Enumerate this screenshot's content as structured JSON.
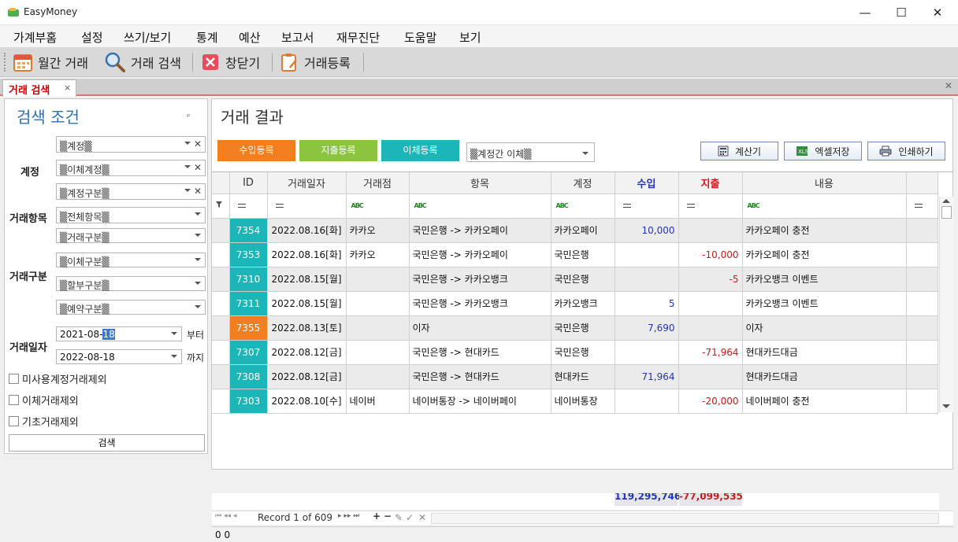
{
  "app": {
    "title": "EasyMoney",
    "win_min": "—",
    "win_max": "☐",
    "win_close": "✕"
  },
  "menu": [
    "가계부홈",
    "설정",
    "쓰기/보기",
    "통계",
    "예산",
    "보고서",
    "재무진단",
    "도움말",
    "보기"
  ],
  "toolbar": {
    "monthly": "월간 거래",
    "search": "거래 검색",
    "close": "창닫기",
    "register": "거래등록"
  },
  "doc_tab": {
    "label": "거래 검색",
    "close": "×"
  },
  "search_panel": {
    "title": "검색 조건",
    "pin": "ₚ",
    "group_account": "계정",
    "group_item": "거래항목",
    "group_type": "거래구분",
    "group_date": "거래일자",
    "account": "▒계정▒",
    "transfer_account": "▒이체계정▒",
    "account_type": "▒계정구분▒",
    "all_items": "▒전체항목▒",
    "trade_type": "▒거래구분▒",
    "transfer_type": "▒이체구분▒",
    "installment_type": "▒할부구분▒",
    "reservation_type": "▒예약구분▒",
    "date_from_prefix": "2021-08-",
    "date_from_sel": "18",
    "date_to": "2022-08-18",
    "from_suffix": "부터",
    "to_suffix": "까지",
    "chk_unused": "미사용계정거래제외",
    "chk_transfer": "이체거래제외",
    "chk_base": "기초거래제외",
    "search_btn": "검색"
  },
  "results": {
    "title": "거래 결과",
    "income_btn": "수입등록",
    "expense_btn": "지출등록",
    "transfer_btn": "이체등록",
    "transfer_filter": "▒계정간 이체▒",
    "calc_btn": "계산기",
    "excel_btn": "엑셀저장",
    "print_btn": "인쇄하기",
    "columns": [
      "ID",
      "거래일자",
      "거래점",
      "항목",
      "계정",
      "수입",
      "지출",
      "내용"
    ],
    "filter_abc": "ABC",
    "rows": [
      {
        "id": "7354",
        "date": "2022.08.16[화]",
        "store": "카카오",
        "item": "국민은행 -> 카카오페이",
        "account": "카카오페이",
        "income": "10,000",
        "expense": "",
        "memo": "카카오페이 충전"
      },
      {
        "id": "7353",
        "date": "2022.08.16[화]",
        "store": "카카오",
        "item": "국민은행 -> 카카오페이",
        "account": "국민은행",
        "income": "",
        "expense": "-10,000",
        "memo": "카카오페이 충전"
      },
      {
        "id": "7310",
        "date": "2022.08.15[월]",
        "store": "",
        "item": "국민은행 -> 카카오뱅크",
        "account": "국민은행",
        "income": "",
        "expense": "-5",
        "memo": "카카오뱅크 이벤트"
      },
      {
        "id": "7311",
        "date": "2022.08.15[월]",
        "store": "",
        "item": "국민은행 -> 카카오뱅크",
        "account": "카카오뱅크",
        "income": "5",
        "expense": "",
        "memo": "카카오뱅크 이벤트"
      },
      {
        "id": "7355",
        "date": "2022.08.13[토]",
        "store": "",
        "item": "이자",
        "account": "국민은행",
        "income": "7,690",
        "expense": "",
        "memo": "이자"
      },
      {
        "id": "7307",
        "date": "2022.08.12[금]",
        "store": "",
        "item": "국민은행 -> 현대카드",
        "account": "국민은행",
        "income": "",
        "expense": "-71,964",
        "memo": "현대카드대금"
      },
      {
        "id": "7308",
        "date": "2022.08.12[금]",
        "store": "",
        "item": "국민은행 -> 현대카드",
        "account": "현대카드",
        "income": "71,964",
        "expense": "",
        "memo": "현대카드대금"
      },
      {
        "id": "7303",
        "date": "2022.08.10[수]",
        "store": "네이버",
        "item": "네이버통장 -> 네이버페이",
        "account": "네이버통장",
        "income": "",
        "expense": "-20,000",
        "memo": "네이버페이 충전"
      }
    ],
    "total_income": "119,295,746",
    "total_expense": "-77,099,535",
    "record_text": "Record 1 of 609",
    "status_text": "0 0"
  },
  "colors": {
    "teal": "#1cb6b8",
    "orange": "#f27e1d",
    "green": "#8bc53f",
    "tab_red": "#cc0000",
    "title_blue": "#2f6fb5",
    "income_blue": "#2035b8",
    "expense_red": "#d01818"
  }
}
